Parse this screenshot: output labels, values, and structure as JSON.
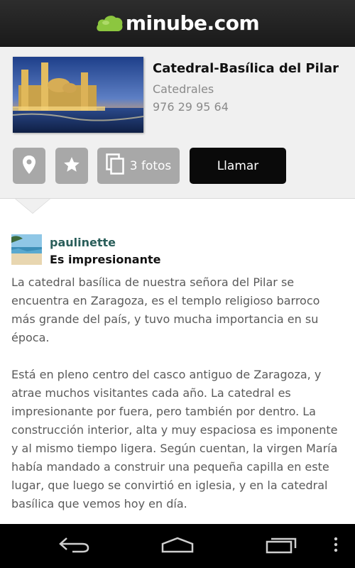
{
  "app": {
    "logo_text": "minube.com",
    "brand_green": "#8cc63f"
  },
  "place": {
    "title": "Catedral-Basílica del Pilar",
    "category": "Catedrales",
    "phone": "976 29 95 64",
    "image_icon": "cathedral-night-photo"
  },
  "actions": {
    "map_icon": "location-pin-icon",
    "favorite_icon": "star-icon",
    "photos_label": "3 fotos",
    "call_label": "Llamar"
  },
  "review": {
    "username": "paulinette",
    "title": "Es impresionante",
    "paragraphs": [
      "La catedral basílica de nuestra señora del Pilar se encuentra en Zaragoza, es el templo religioso barroco más grande del país, y tuvo mucha importancia en su época.",
      "Está en pleno centro del casco antiguo de Zaragoza, y atrae muchos visitantes cada año. La catedral es impresionante por fuera, pero también por dentro. La construcción interior, alta y muy espaciosa es imponente y al mismo tiempo ligera. Según cuentan, la virgen María había mandado a construir una pequeña capilla en este lugar, que luego se convirtió en iglesia, y en la catedral basílica que vemos hoy en día."
    ]
  },
  "navbar": {
    "back_icon": "back-icon",
    "home_icon": "home-icon",
    "recents_icon": "recents-icon",
    "menu_icon": "overflow-menu-icon"
  }
}
